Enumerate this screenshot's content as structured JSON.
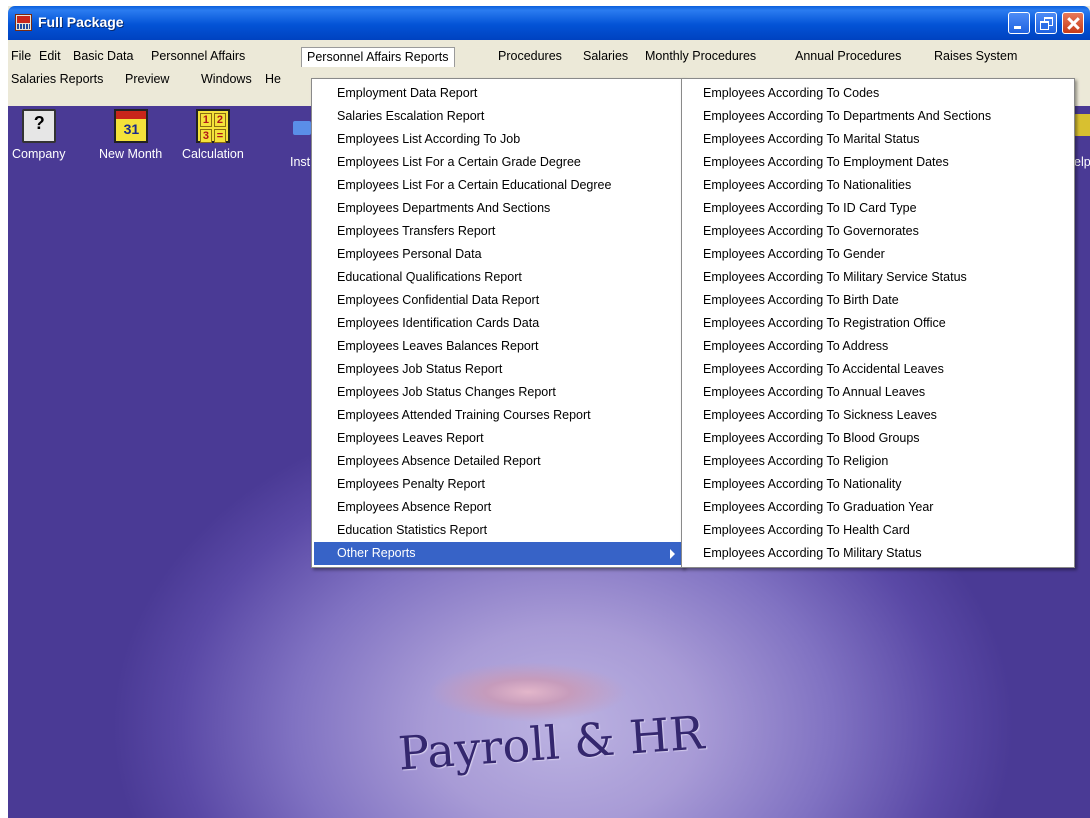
{
  "window": {
    "title": "Full Package"
  },
  "menubar": {
    "row1": [
      "File",
      "Edit",
      "Basic Data",
      "Personnel Affairs",
      "Personnel Affairs Reports",
      "Procedures",
      "Salaries",
      "Monthly Procedures",
      "Annual Procedures",
      "Raises System"
    ],
    "row2": [
      "Salaries Reports",
      "Preview",
      "Windows",
      "He"
    ]
  },
  "toolbar": {
    "items": [
      {
        "label": "Company",
        "icon": "computer-help-icon"
      },
      {
        "label": "New Month",
        "icon": "calendar-icon"
      },
      {
        "label": "Calculation",
        "icon": "calculator-icon"
      }
    ],
    "fragment_inst": "Inst",
    "fragment_help": "elp"
  },
  "report_menu": {
    "items": [
      "Employment Data Report",
      "Salaries Escalation Report",
      "Employees  List According To Job",
      "Employees List For a Certain Grade Degree",
      "Employees List For a Certain Educational Degree",
      "Employees Departments And Sections",
      "Employees Transfers Report",
      "Employees Personal Data",
      "Educational Qualifications Report",
      "Employees Confidential Data Report",
      "Employees Identification Cards Data",
      "Employees Leaves Balances Report",
      "Employees Job Status  Report",
      "Employees Job Status Changes Report",
      "Employees Attended Training Courses Report",
      "Employees Leaves Report",
      "Employees Absence Detailed Report",
      "Employees Penalty Report",
      "Employees Absence Report",
      "Education Statistics Report",
      "Other  Reports"
    ]
  },
  "submenu": {
    "items": [
      "Employees According To Codes",
      "Employees According To Departments And Sections",
      "Employees According To Marital Status",
      "Employees According To Employment Dates",
      "Employees According To  Nationalities",
      "Employees According To ID Card Type",
      "Employees According To Governorates",
      "Employees According To Gender",
      "Employees According To Military Service Status",
      "Employees According To Birth Date",
      "Employees According To Registration Office",
      "Employees According To Address",
      "Employees According To  Accidental Leaves",
      "Employees According To Annual Leaves",
      "Employees According To Sickness Leaves",
      "Employees According To Blood Groups",
      "Employees According To Religion",
      "Employees According To Nationality",
      "Employees According To Graduation Year",
      "Employees According To Health Card",
      "Employees According To Military Status"
    ]
  },
  "logo_text": "Payroll & HR",
  "colors": {
    "titlebar": "#0353d6",
    "menu_highlight": "#3763c7",
    "workspace": "#7a6cc0"
  }
}
